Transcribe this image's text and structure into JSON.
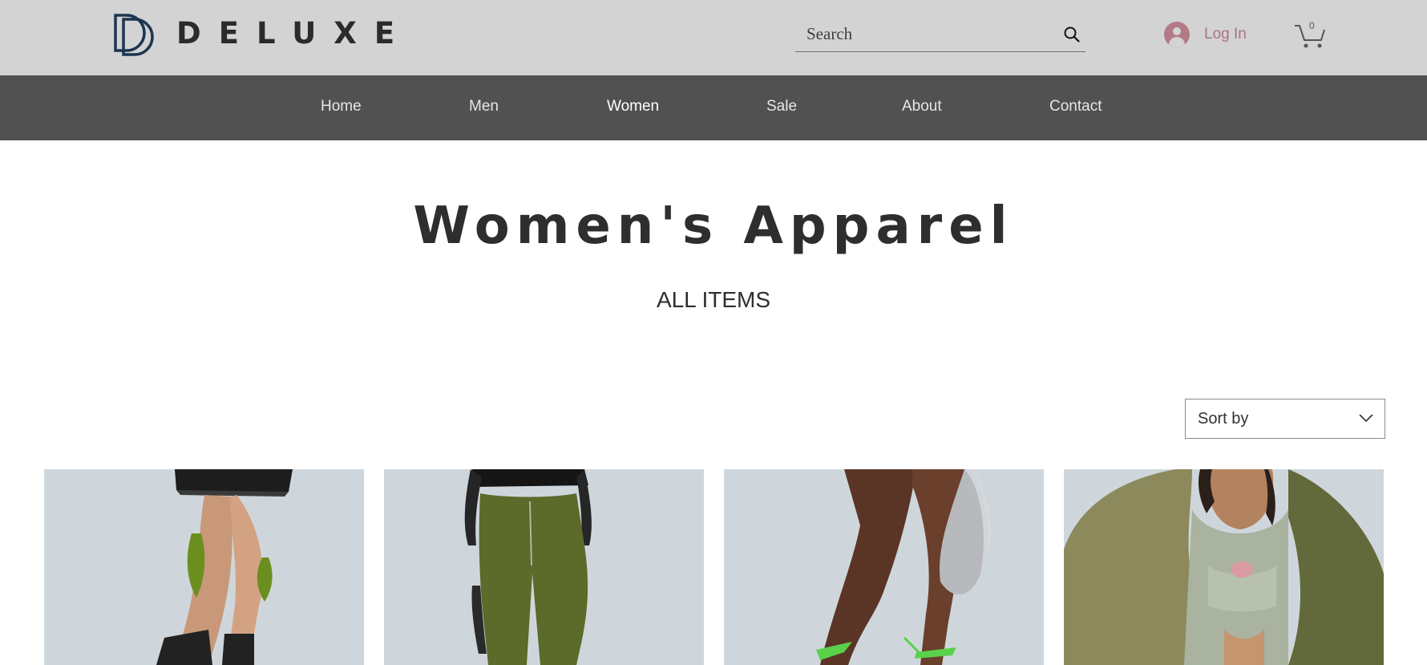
{
  "brand": {
    "name": "DELUXE",
    "logo": "double-d-monogram-logo"
  },
  "search": {
    "placeholder": "Search",
    "icon": "search-icon"
  },
  "account": {
    "login_label": "Log In",
    "icon": "user-avatar-icon"
  },
  "cart": {
    "count": "0",
    "icon": "cart-icon"
  },
  "nav": {
    "items": [
      {
        "label": "Home"
      },
      {
        "label": "Men"
      },
      {
        "label": "Women"
      },
      {
        "label": "Sale"
      },
      {
        "label": "About"
      },
      {
        "label": "Contact"
      }
    ],
    "active": "Women"
  },
  "page": {
    "title": "Women's Apparel",
    "subtitle": "ALL ITEMS"
  },
  "sort": {
    "label": "Sort by",
    "icon": "chevron-down-icon"
  },
  "products": [
    {
      "image": "legs-black-lace-skirt-ankle-boots"
    },
    {
      "image": "olive-cargo-trousers-mesh-top"
    },
    {
      "image": "legs-green-strappy-heels-silver-bag"
    },
    {
      "image": "olive-bomber-jacket-crop-top"
    }
  ],
  "colors": {
    "header_bg": "#d3d3d3",
    "nav_bg": "#525151",
    "login_accent": "#a9737f",
    "logo_blue": "#1d3550",
    "product_bg": "#cfd6db"
  }
}
